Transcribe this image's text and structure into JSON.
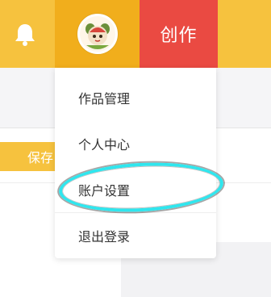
{
  "header": {
    "create_label": "创作",
    "icons": {
      "bell": "bell-icon",
      "avatar": "user-avatar"
    },
    "colors": {
      "bar": "#f6c23e",
      "avatar_tab": "#f1ae1c",
      "create": "#ea4a42"
    }
  },
  "page": {
    "save_label": "保存"
  },
  "user_menu": {
    "items": [
      {
        "label": "作品管理"
      },
      {
        "label": "个人中心"
      },
      {
        "label": "账户设置",
        "annotated": true
      },
      {
        "label": "退出登录"
      }
    ],
    "annotation_color": "#2fe6ee"
  }
}
